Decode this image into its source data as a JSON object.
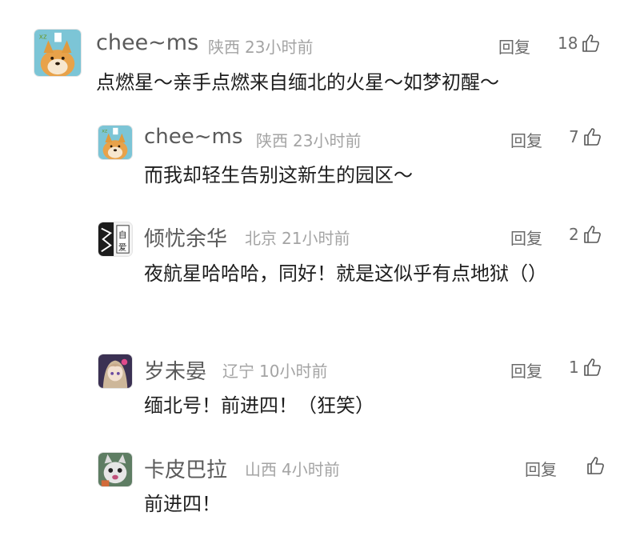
{
  "comments": [
    {
      "user": "chee~ms",
      "location": "陕西",
      "time": "23小时前",
      "reply_label": "回复",
      "likes": "18",
      "text": "点燃星～亲手点燃来自缅北的火星～如梦初醒～",
      "avatar_icon": "shiba-dog-avatar"
    },
    {
      "user": "chee~ms",
      "location": "陕西",
      "time": "23小时前",
      "reply_label": "回复",
      "likes": "7",
      "text": "而我却轻生告别这新生的园区～",
      "avatar_icon": "shiba-dog-avatar"
    },
    {
      "user": "倾忧余华",
      "location": "北京",
      "time": "21小时前",
      "reply_label": "回复",
      "likes": "2",
      "text": "夜航星哈哈哈，同好！就是这似乎有点地狱（）",
      "avatar_icon": "manga-avatar"
    },
    {
      "user": "岁未晏",
      "location": "辽宁",
      "time": "10小时前",
      "reply_label": "回复",
      "likes": "1",
      "text": "缅北号！前进四！（狂笑）",
      "avatar_icon": "anime-character-avatar"
    },
    {
      "user": "卡皮巴拉",
      "location": "山西",
      "time": "4小时前",
      "reply_label": "回复",
      "likes": "",
      "text": "前进四！",
      "avatar_icon": "cat-avatar"
    }
  ],
  "colors": {
    "meta": "#a4a4a4",
    "name": "#5a5a5a",
    "content": "#1e1e1e"
  }
}
